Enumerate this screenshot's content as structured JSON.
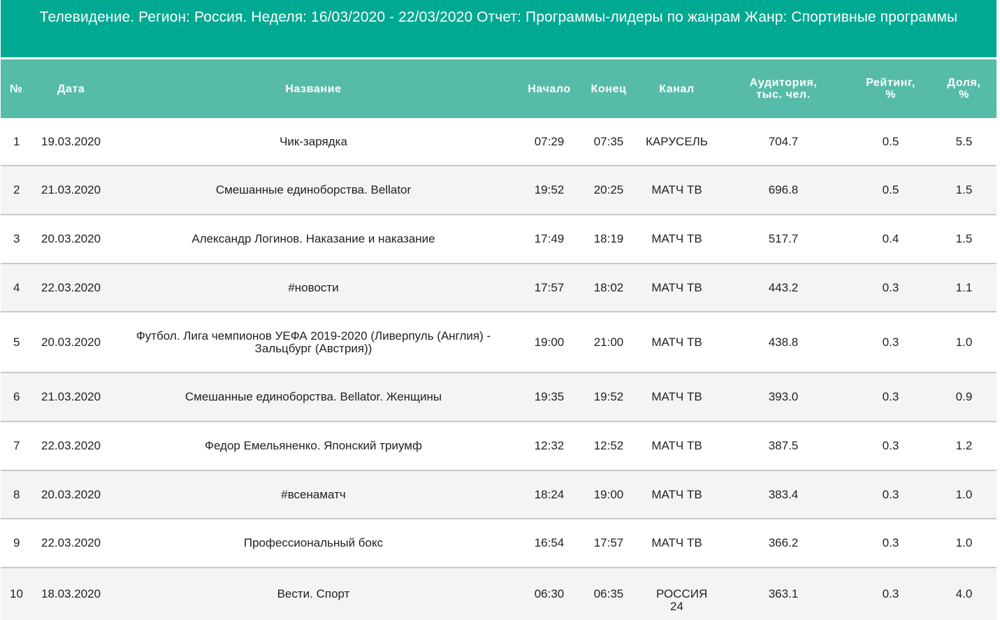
{
  "title": "Телевидение. Регион: Россия. Неделя: 16/03/2020 - 22/03/2020 Отчет: Программы-лидеры по жанрам Жанр: Спортивные программы",
  "columns": {
    "num": "№",
    "date": "Дата",
    "name": "Название",
    "start": "Начало",
    "end": "Конец",
    "channel": "Канал",
    "audience": "Аудитория, тыс. чел.",
    "rating": "Рейтинг, %",
    "share": "Доля, %"
  },
  "rows": [
    {
      "num": "1",
      "date": "19.03.2020",
      "name": "Чик-зарядка",
      "start": "07:29",
      "end": "07:35",
      "channel": "КАРУСЕЛЬ",
      "audience": "704.7",
      "rating": "0.5",
      "share": "5.5"
    },
    {
      "num": "2",
      "date": "21.03.2020",
      "name": "Смешанные единоборства. Bellator",
      "start": "19:52",
      "end": "20:25",
      "channel": "МАТЧ ТВ",
      "audience": "696.8",
      "rating": "0.5",
      "share": "1.5"
    },
    {
      "num": "3",
      "date": "20.03.2020",
      "name": "Александр Логинов. Наказание и наказание",
      "start": "17:49",
      "end": "18:19",
      "channel": "МАТЧ ТВ",
      "audience": "517.7",
      "rating": "0.4",
      "share": "1.5"
    },
    {
      "num": "4",
      "date": "22.03.2020",
      "name": "#новости",
      "start": "17:57",
      "end": "18:02",
      "channel": "МАТЧ ТВ",
      "audience": "443.2",
      "rating": "0.3",
      "share": "1.1"
    },
    {
      "num": "5",
      "date": "20.03.2020",
      "name": "Футбол. Лига чемпионов УЕФА 2019-2020 (Ливерпуль (Англия) - Зальцбург (Австрия))",
      "start": "19:00",
      "end": "21:00",
      "channel": "МАТЧ ТВ",
      "audience": "438.8",
      "rating": "0.3",
      "share": "1.0"
    },
    {
      "num": "6",
      "date": "21.03.2020",
      "name": "Смешанные единоборства. Bellator. Женщины",
      "start": "19:35",
      "end": "19:52",
      "channel": "МАТЧ ТВ",
      "audience": "393.0",
      "rating": "0.3",
      "share": "0.9"
    },
    {
      "num": "7",
      "date": "22.03.2020",
      "name": "Федор Емельяненко. Японский триумф",
      "start": "12:32",
      "end": "12:52",
      "channel": "МАТЧ ТВ",
      "audience": "387.5",
      "rating": "0.3",
      "share": "1.2"
    },
    {
      "num": "8",
      "date": "20.03.2020",
      "name": "#всенаматч",
      "start": "18:24",
      "end": "19:00",
      "channel": "МАТЧ ТВ",
      "audience": "383.4",
      "rating": "0.3",
      "share": "1.0"
    },
    {
      "num": "9",
      "date": "22.03.2020",
      "name": "Профессиональный бокс",
      "start": "16:54",
      "end": "17:57",
      "channel": "МАТЧ ТВ",
      "audience": "366.2",
      "rating": "0.3",
      "share": "1.0"
    },
    {
      "num": "10",
      "date": "18.03.2020",
      "name": "Вести. Спорт",
      "start": "06:30",
      "end": "06:35",
      "channel": "РОССИЯ 24",
      "audience": "363.1",
      "rating": "0.3",
      "share": "4.0"
    }
  ]
}
